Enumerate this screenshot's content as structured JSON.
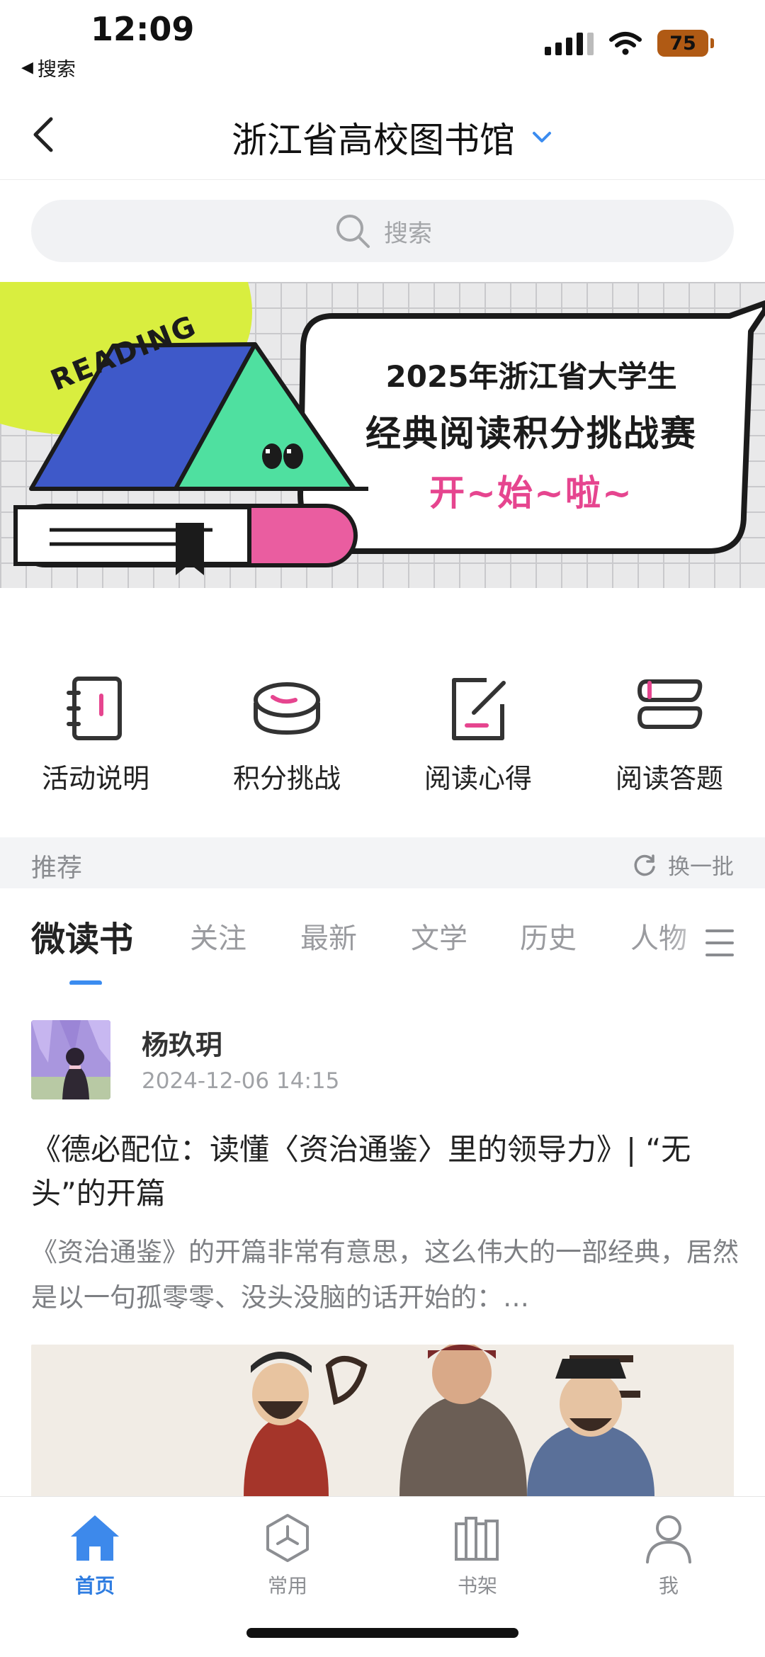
{
  "status_bar": {
    "time": "12:09",
    "back_app": "搜索",
    "battery": "75",
    "battery_color": "#b05a14"
  },
  "nav": {
    "title": "浙江省高校图书馆",
    "back_icon": "chevron-left-icon",
    "dropdown_icon": "chevron-down-icon",
    "accent": "#3b8cf0"
  },
  "search": {
    "placeholder": "搜索"
  },
  "banner": {
    "badge": "READING",
    "line1": "2025年浙江省大学生",
    "line2": "经典阅读积分挑战赛",
    "line3": "开~始~啦~"
  },
  "quick_actions": [
    {
      "label": "活动说明",
      "icon": "notebook-icon"
    },
    {
      "label": "积分挑战",
      "icon": "coins-icon"
    },
    {
      "label": "阅读心得",
      "icon": "edit-note-icon"
    },
    {
      "label": "阅读答题",
      "icon": "quiz-icon"
    }
  ],
  "recommend": {
    "title": "推荐",
    "refresh_label": "换一批"
  },
  "tabs": [
    {
      "label": "微读书",
      "active": true
    },
    {
      "label": "关注"
    },
    {
      "label": "最新"
    },
    {
      "label": "文学"
    },
    {
      "label": "历史"
    },
    {
      "label": "人物"
    }
  ],
  "post": {
    "author": "杨玖玥",
    "date": "2024-12-06 14:15",
    "title": "《德必配位：读懂〈资治通鉴〉里的领导力》| “无头”的开篇",
    "excerpt": "《资治通鉴》的开篇非常有意思，这么伟大的一部经典，居然是以一句孤零零、没头没脑的话开始的：…"
  },
  "tabbar": [
    {
      "label": "首页",
      "icon": "home-icon",
      "active": true
    },
    {
      "label": "常用",
      "icon": "apps-icon"
    },
    {
      "label": "书架",
      "icon": "bookshelf-icon"
    },
    {
      "label": "我",
      "icon": "user-icon"
    }
  ],
  "colors": {
    "active_blue": "#2f7de1",
    "pink": "#e6458f",
    "muted": "#8a8c90"
  }
}
